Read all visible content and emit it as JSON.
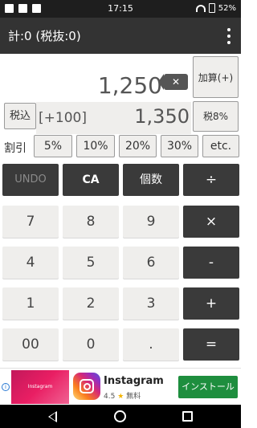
{
  "status_bar": {
    "time": "17:15",
    "battery": "52%"
  },
  "app_bar": {
    "title": "計:0 (税抜:0)",
    "menu_icon": "more-vert-icon"
  },
  "display": {
    "main_value": "1,250",
    "backspace_icon": "backspace-icon",
    "add_button": "加算(+)",
    "tax_incl_button": "税込",
    "add_amount": "[+100]",
    "sub_value": "1,350",
    "tax_rate_button": "税8%"
  },
  "discount": {
    "label": "割引",
    "options": [
      "5%",
      "10%",
      "20%",
      "30%",
      "etc."
    ]
  },
  "keypad": {
    "undo": "UNDO",
    "ca": "CA",
    "count": "個数",
    "divide": "÷",
    "n7": "7",
    "n8": "8",
    "n9": "9",
    "multiply": "×",
    "n4": "4",
    "n5": "5",
    "n6": "6",
    "minus": "-",
    "n1": "1",
    "n2": "2",
    "n3": "3",
    "plus": "+",
    "n00": "00",
    "n0": "0",
    "dot": ".",
    "equals": "="
  },
  "ad": {
    "app_name": "Instagram",
    "rating": "4.5",
    "price": "無料",
    "install_label": "インストール",
    "thumb_text": "Instagram"
  },
  "colors": {
    "dark_key": "#3a3a3a",
    "light_key": "#efeeec",
    "app_bar": "#333333",
    "install": "#1e8e3e"
  }
}
